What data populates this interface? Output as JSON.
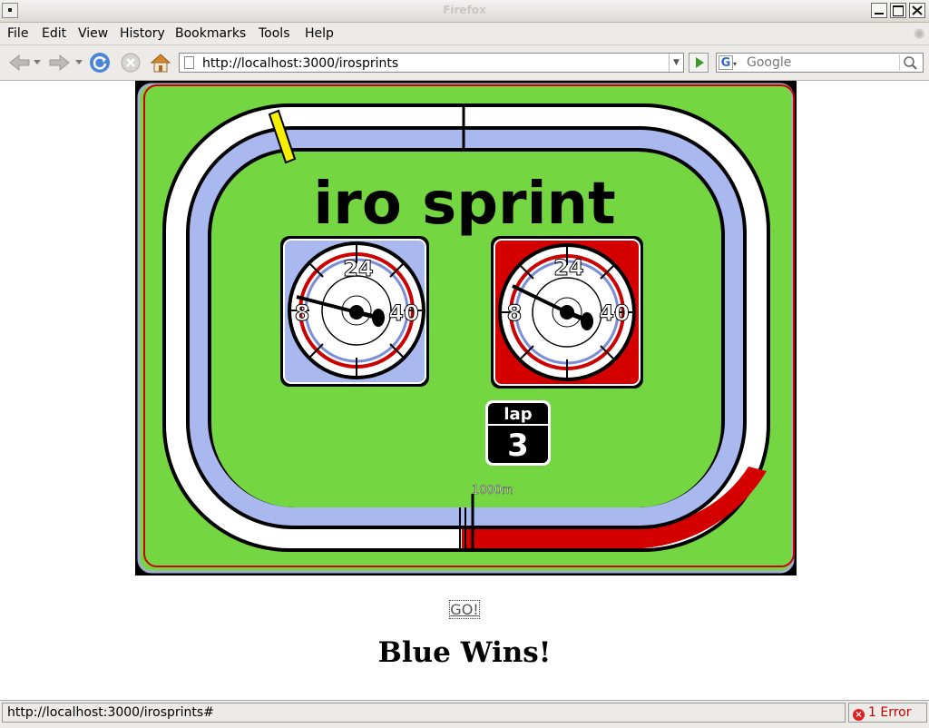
{
  "window": {
    "title": "Firefox"
  },
  "menu": [
    "File",
    "Edit",
    "View",
    "History",
    "Bookmarks",
    "Tools",
    "Help"
  ],
  "toolbar": {
    "url": "http://localhost:3000/irosprints",
    "search_placeholder": "Google"
  },
  "game": {
    "title": "iro sprint",
    "gauge_blue": {
      "ticks": [
        "8",
        "24",
        "40"
      ]
    },
    "gauge_red": {
      "ticks": [
        "8",
        "24",
        "40"
      ]
    },
    "lap_label": "lap",
    "lap_value": "3",
    "distance_label": "1000m"
  },
  "page": {
    "go_label": "GO!",
    "result": "Blue Wins!"
  },
  "status": {
    "text": "http://localhost:3000/irosprints#",
    "error": "1 Error"
  },
  "colors": {
    "grass": "#74d640",
    "blue_lane": "#a9b8ee",
    "red_lane": "#d40000",
    "white_lane": "#ffffff"
  }
}
